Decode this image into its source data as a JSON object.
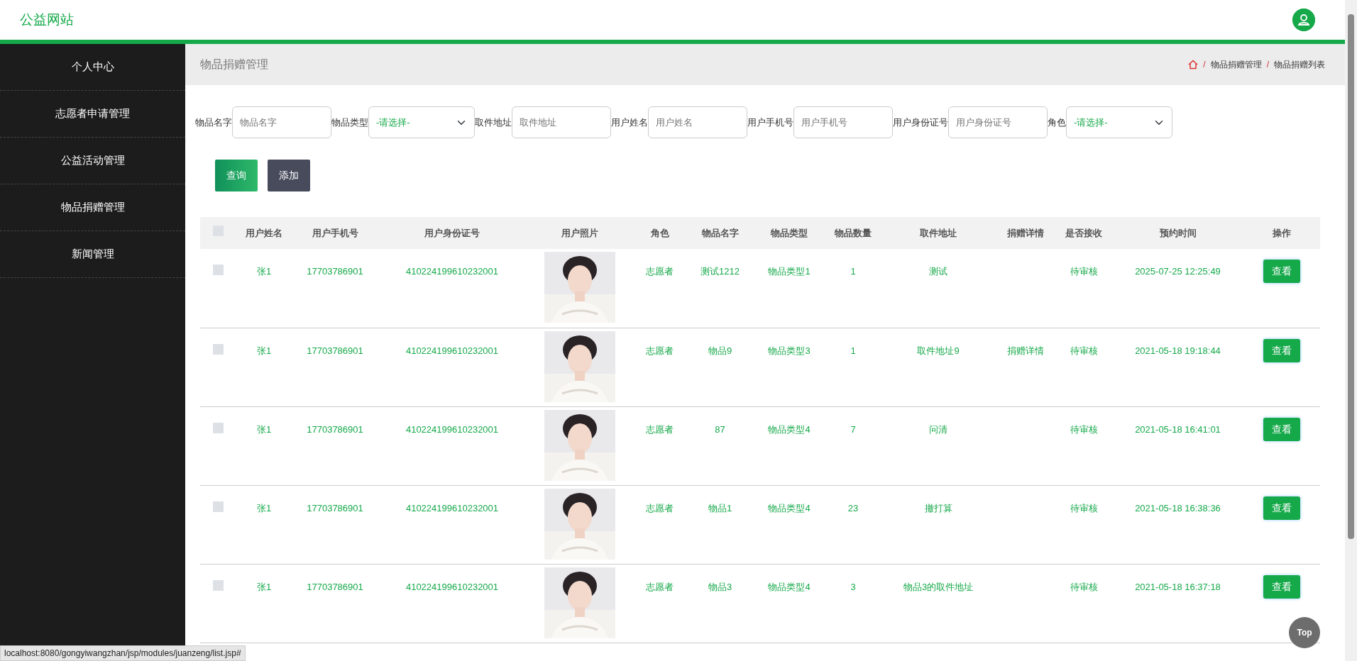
{
  "header": {
    "brand": "公益网站"
  },
  "sidebar": {
    "items": [
      {
        "label": "个人中心",
        "selected": false
      },
      {
        "label": "志愿者申请管理",
        "selected": false
      },
      {
        "label": "公益活动管理",
        "selected": false
      },
      {
        "label": "物品捐赠管理",
        "selected": false
      },
      {
        "label": "新闻管理",
        "selected": false
      }
    ]
  },
  "page_title": "物品捐赠管理",
  "breadcrumb": [
    {
      "separator": "/",
      "label": "物品捐赠管理"
    },
    {
      "separator": "/",
      "label": "物品捐赠列表"
    }
  ],
  "filters": [
    {
      "kind": "input",
      "label": "物品名字",
      "placeholder": "物品名字"
    },
    {
      "kind": "select",
      "label": "物品类型",
      "value": "-请选择-"
    },
    {
      "kind": "input",
      "label": "取件地址",
      "placeholder": "取件地址"
    },
    {
      "kind": "input",
      "label": "用户姓名",
      "placeholder": "用户姓名"
    },
    {
      "kind": "input",
      "label": "用户手机号",
      "placeholder": "用户手机号"
    },
    {
      "kind": "input",
      "label": "用户身份证号",
      "placeholder": "用户身份证号"
    },
    {
      "kind": "select",
      "label": "角色",
      "value": "-请选择-"
    }
  ],
  "actions": [
    {
      "label": "查询",
      "kind": "search"
    },
    {
      "label": "添加",
      "kind": "add"
    }
  ],
  "table": {
    "select_all": {
      "checked": false
    },
    "columns": [
      "用户姓名",
      "用户手机号",
      "用户身份证号",
      "用户照片",
      "角色",
      "物品名字",
      "物品类型",
      "物品数量",
      "取件地址",
      "捐赠详情",
      "是否接收",
      "预约时间",
      "操作"
    ],
    "rows": [
      {
        "checked": false,
        "cells": [
          "张1",
          "17703786901",
          "410224199610232001",
          {
            "kind": "picture"
          },
          "志愿者",
          "测试1212",
          "物品类型1",
          "1",
          "测试",
          "",
          "待审核",
          "2025-07-25 12:25:49"
        ],
        "button": "查看"
      },
      {
        "checked": false,
        "cells": [
          "张1",
          "17703786901",
          "410224199610232001",
          {
            "kind": "picture"
          },
          "志愿者",
          "物品9",
          "物品类型3",
          "1",
          "取件地址9",
          "捐赠详情",
          "待审核",
          "2021-05-18 19:18:44"
        ],
        "button": "查看"
      },
      {
        "checked": false,
        "cells": [
          "张1",
          "17703786901",
          "410224199610232001",
          {
            "kind": "picture"
          },
          "志愿者",
          "87",
          "物品类型4",
          "7",
          "问清",
          "",
          "待审核",
          "2021-05-18 16:41:01"
        ],
        "button": "查看"
      },
      {
        "checked": false,
        "cells": [
          "张1",
          "17703786901",
          "410224199610232001",
          {
            "kind": "picture"
          },
          "志愿者",
          "物品1",
          "物品类型4",
          "23",
          "撤打算",
          "",
          "待审核",
          "2021-05-18 16:38:36"
        ],
        "button": "查看"
      },
      {
        "checked": false,
        "cells": [
          "张1",
          "17703786901",
          "410224199610232001",
          {
            "kind": "picture"
          },
          "志愿者",
          "物品3",
          "物品类型4",
          "3",
          "物品3的取件地址",
          "",
          "待审核",
          "2021-05-18 16:37:18"
        ],
        "button": "查看"
      }
    ]
  },
  "top_button": "Top",
  "status_bar": "localhost:8080/gongyiwangzhan/jsp/modules/juanzeng/list.jsp#"
}
